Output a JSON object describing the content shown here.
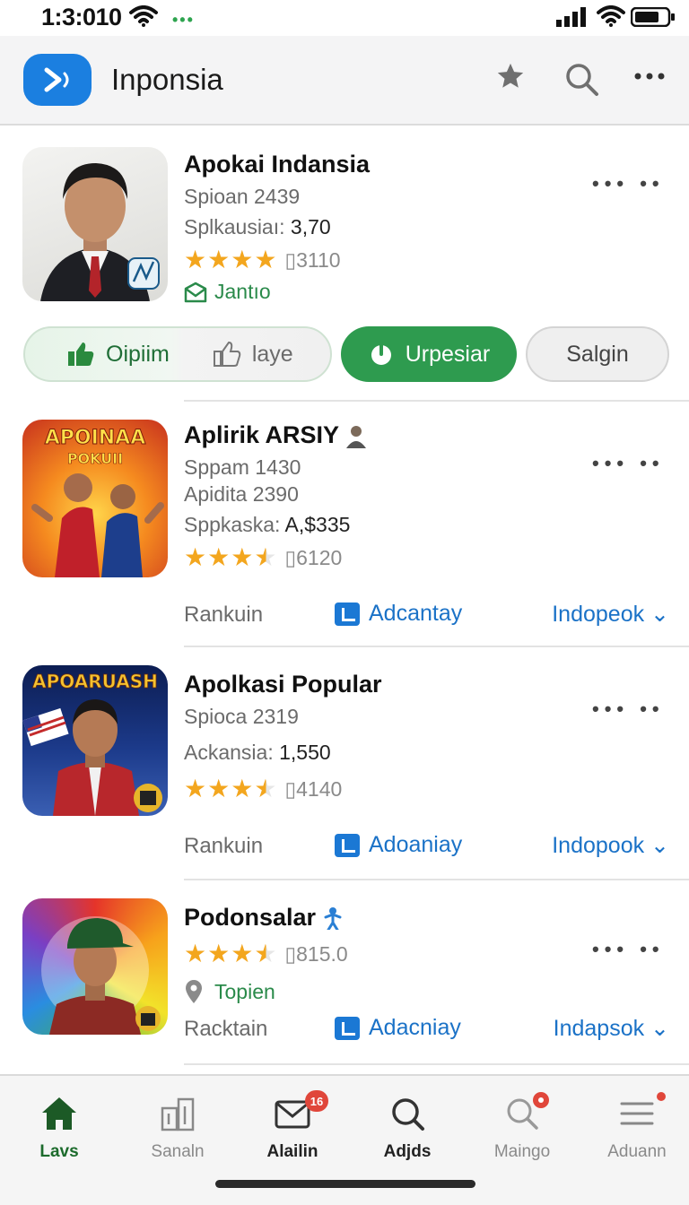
{
  "status": {
    "time": "1:3:010"
  },
  "appbar": {
    "title": "Inponsia"
  },
  "apps": [
    {
      "name": "Apokai Indansia",
      "meta1": "Spioan 2439",
      "meta2_label": "Splkausiaı: ",
      "meta2_value": "3,70",
      "rating": 4,
      "rating_count": "3110",
      "tag": "Jantıo"
    },
    {
      "name": "Aplirik ARSIY",
      "meta1": "Sppam 1430",
      "meta2": "Apidita 2390",
      "meta3_label": "Sppkaska: ",
      "meta3_value": "A,$335",
      "rating": 3.5,
      "rating_count": "6120",
      "rank": "Rankuin",
      "ad": "Adcantay",
      "ind": "Indopeok ⌄",
      "thumb_text": [
        "APOINAA",
        "POKUII"
      ]
    },
    {
      "name": "Apolkasi Popular",
      "meta1": "Spioca 2319",
      "meta2_label": "Ackansia: ",
      "meta2_value": "1,550",
      "rating": 3.5,
      "rating_count": "4140",
      "rank": "Rankuin",
      "ad": "Adoaniay",
      "ind": "Indopook ⌄",
      "thumb_text": [
        "APOARUASH"
      ]
    },
    {
      "name": "Podonsalar",
      "rating": 3.5,
      "rating_count": "815.0",
      "tag": "Topien",
      "rank": "Racktain",
      "ad": "Adacniay",
      "ind": "Indapsok ⌄"
    }
  ],
  "actions": {
    "opinion": "Oipiim",
    "like": "laye",
    "primary": "Urpesiar",
    "secondary": "Salgin"
  },
  "nav": [
    {
      "label": "Lavs",
      "badge": ""
    },
    {
      "label": "Sanaln",
      "badge": ""
    },
    {
      "label": "Alailin",
      "badge": "16"
    },
    {
      "label": "Adjds",
      "badge": ""
    },
    {
      "label": "Maingo",
      "badge": ""
    },
    {
      "label": "Aduann",
      "badge": ""
    }
  ],
  "colors": {
    "accent": "#2e9b4f",
    "link": "#1b72c7",
    "star": "#f3a61e",
    "brand": "#1b7fe0"
  }
}
